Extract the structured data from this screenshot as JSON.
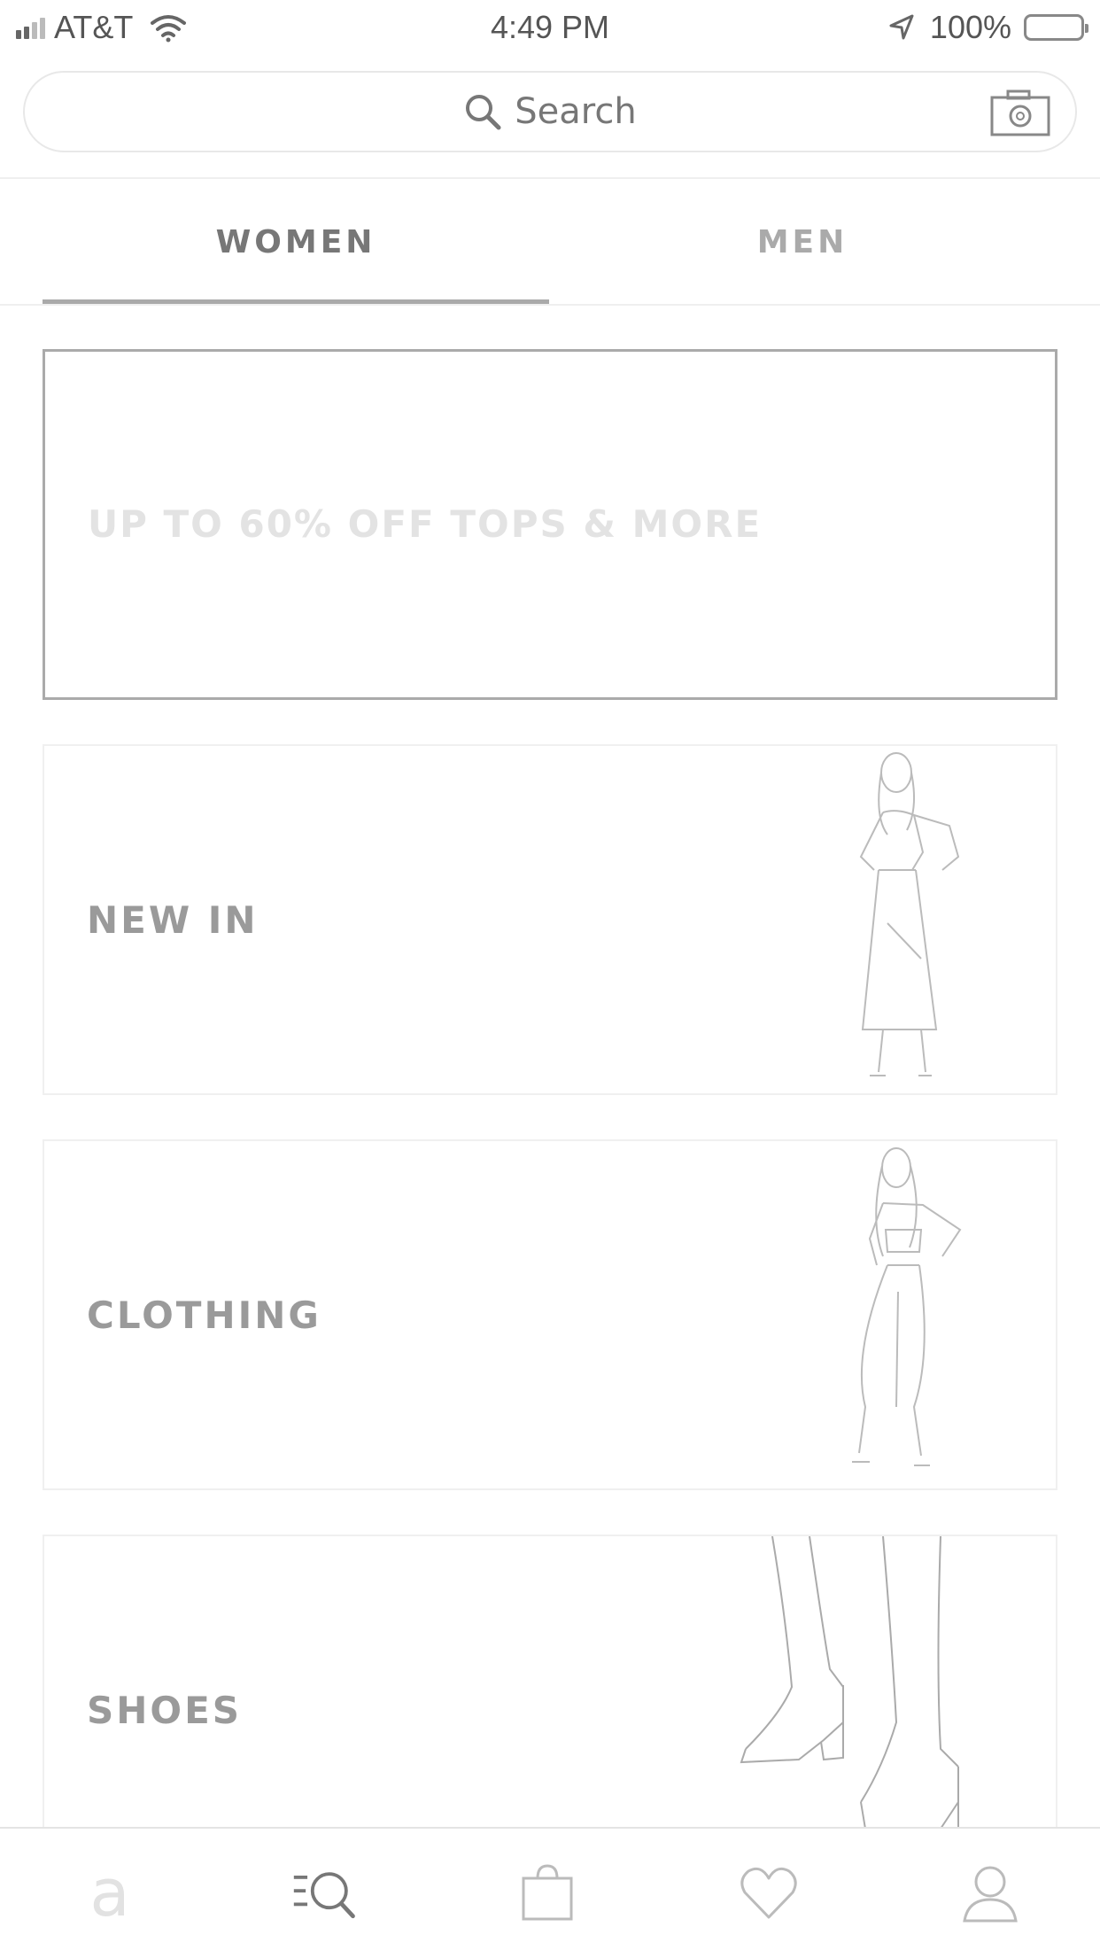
{
  "status_bar": {
    "carrier": "AT&T",
    "time": "4:49 PM",
    "battery": "100%"
  },
  "search": {
    "placeholder": "Search"
  },
  "tabs": [
    {
      "label": "WOMEN",
      "active": true
    },
    {
      "label": "MEN",
      "active": false
    }
  ],
  "promo": {
    "text": "UP TO 60% OFF TOPS & MORE"
  },
  "categories": [
    {
      "label": "NEW IN"
    },
    {
      "label": "CLOTHING"
    },
    {
      "label": "SHOES"
    }
  ],
  "bottom_nav": {
    "items": [
      "a-logo-icon",
      "search-menu-icon",
      "shopping-bag-icon",
      "heart-icon",
      "profile-icon"
    ],
    "logo_text": "a"
  }
}
